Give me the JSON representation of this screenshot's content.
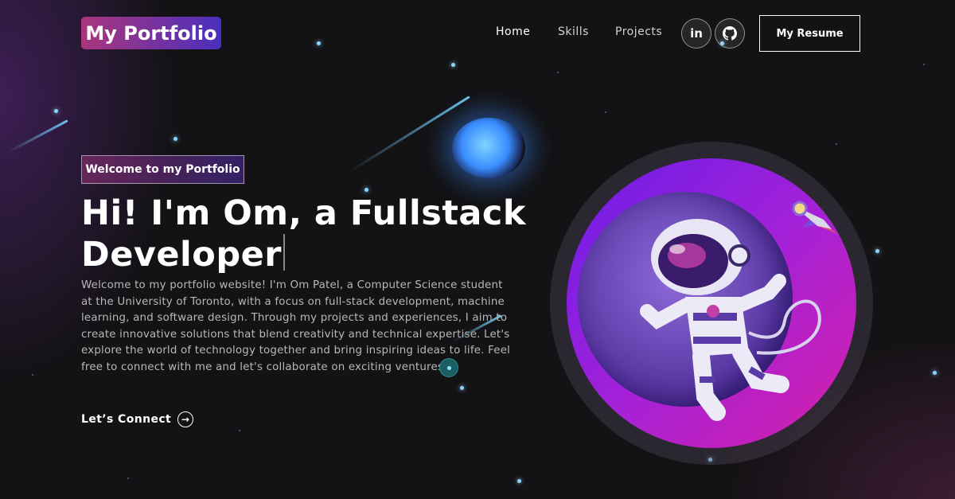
{
  "nav": {
    "logo": "My Portfolio",
    "links": [
      {
        "label": "Home"
      },
      {
        "label": "Skills"
      },
      {
        "label": "Projects"
      }
    ],
    "social": [
      {
        "icon": "linkedin-icon",
        "glyph": "in"
      },
      {
        "icon": "github-icon"
      }
    ],
    "resume_label": "My Resume"
  },
  "hero": {
    "tagline": "Welcome to my Portfolio",
    "headline": "Hi! I'm Om, a Fullstack Developer",
    "intro": "Welcome to my portfolio website! I'm Om Patel, a Computer Science student at the University of Toronto, with a focus on full-stack development, machine learning, and software design. Through my projects and experiences, I aim to create innovative solutions that blend creativity and technical expertise. Let's explore the world of technology together and bring inspiring ideas to life. Feel free to connect with me and let's collaborate on exciting ventures!",
    "connect_label": "Let’s Connect",
    "connect_icon": "arrow-right-circle-icon"
  },
  "colors": {
    "background": "#121212",
    "gradient_start": "#aa367c",
    "gradient_end": "#4a2fbd",
    "text_muted": "#b8b8b8",
    "planet_purple": "#6a1de8",
    "planet_magenta": "#d620a8"
  },
  "illustration": {
    "subject": "astronaut-illustration",
    "decorations": [
      "planet-icon",
      "rocket-icon",
      "blue-orb-icon"
    ]
  }
}
